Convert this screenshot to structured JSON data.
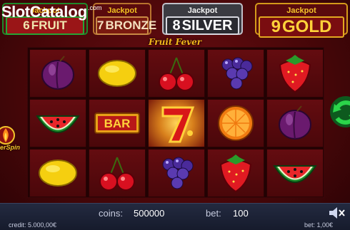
{
  "watermark": {
    "slot": "Slot",
    "catalog": "Catalog",
    "com": ".com"
  },
  "jackpots": [
    {
      "label": "Jackpot",
      "num": "6",
      "name": "FRUIT",
      "color": "#27a535"
    },
    {
      "label": "Jackpot",
      "num": "7",
      "name": "BRONZE",
      "color": "#c98a45"
    },
    {
      "label": "Jackpot",
      "num": "8",
      "name": "SILVER",
      "color": "#d8d8e0"
    },
    {
      "label": "Jackpot",
      "num": "9",
      "name": "GOLD",
      "color": "#e2a920"
    }
  ],
  "title": "Fruit Fever",
  "reels": [
    [
      "plum",
      "watermelon",
      "lemon"
    ],
    [
      "lemon",
      "bar",
      "cherry"
    ],
    [
      "cherry",
      "seven",
      "grapes"
    ],
    [
      "grapes",
      "orange",
      "strawberry"
    ],
    [
      "strawberry",
      "plum",
      "watermelon"
    ]
  ],
  "bar_text": "BAR",
  "side": {
    "bonus_label": "erSpin",
    "spin_icon": "refresh-arrows-icon"
  },
  "footer": {
    "coins_label": "coins:",
    "coins_value": "500000",
    "bet_label": "bet:",
    "bet_value": "100",
    "credit": "credit: 5.000,00€",
    "bet_money": "bet: 1,00€"
  },
  "icons": {
    "sound": "speaker-muted-icon"
  }
}
